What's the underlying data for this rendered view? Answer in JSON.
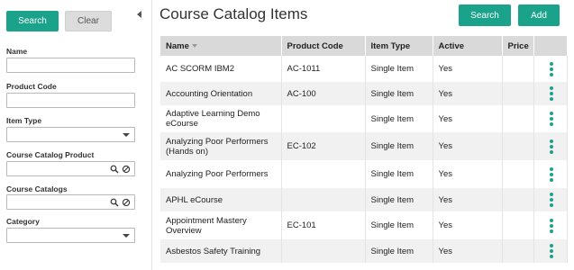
{
  "sidebar": {
    "search_label": "Search",
    "clear_label": "Clear",
    "fields": {
      "name": "Name",
      "product_code": "Product Code",
      "item_type": "Item Type",
      "course_catalog_product": "Course Catalog Product",
      "course_catalogs": "Course Catalogs",
      "category": "Category"
    }
  },
  "header": {
    "title": "Course Catalog Items",
    "search_label": "Search",
    "add_label": "Add"
  },
  "table": {
    "columns": [
      "Name",
      "Product Code",
      "Item Type",
      "Active",
      "Price"
    ],
    "rows": [
      {
        "name": "AC SCORM IBM2",
        "code": "AC-1011",
        "type": "Single Item",
        "active": "Yes",
        "price": ""
      },
      {
        "name": "Accounting Orientation",
        "code": "AC-100",
        "type": "Single Item",
        "active": "Yes",
        "price": ""
      },
      {
        "name": "Adaptive Learning Demo eCourse",
        "code": "",
        "type": "Single Item",
        "active": "Yes",
        "price": ""
      },
      {
        "name": "Analyzing Poor Performers (Hands on)",
        "code": "EC-102",
        "type": "Single Item",
        "active": "Yes",
        "price": ""
      },
      {
        "name": "Analyzing Poor Performers",
        "code": "",
        "type": "Single Item",
        "active": "Yes",
        "price": ""
      },
      {
        "name": "APHL eCourse",
        "code": "",
        "type": "Single Item",
        "active": "Yes",
        "price": ""
      },
      {
        "name": "Appointment Mastery Overview",
        "code": "EC-101",
        "type": "Single Item",
        "active": "Yes",
        "price": ""
      },
      {
        "name": "Asbestos Safety Training",
        "code": "",
        "type": "Single Item",
        "active": "Yes",
        "price": ""
      }
    ]
  },
  "colors": {
    "accent": "#1aa38a",
    "header_bg": "#d9d9d9",
    "alt_row": "#f1f1f1"
  }
}
